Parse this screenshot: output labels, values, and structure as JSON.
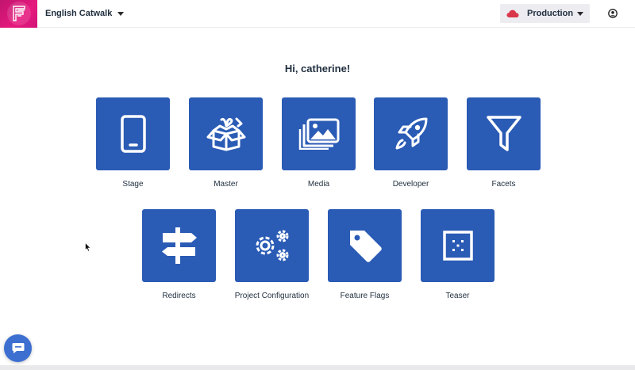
{
  "header": {
    "project_name": "English Catwalk",
    "environment": "Production",
    "brand_color": "#e6197e",
    "environment_icon_color": "#d9364a"
  },
  "main": {
    "greeting": "Hi, catherine!",
    "tile_color": "#2a5bb5",
    "tiles": [
      {
        "label": "Stage",
        "icon": "smartphone-icon"
      },
      {
        "label": "Master",
        "icon": "open-box-icon"
      },
      {
        "label": "Media",
        "icon": "images-icon"
      },
      {
        "label": "Developer",
        "icon": "rocket-icon"
      },
      {
        "label": "Facets",
        "icon": "filter-funnel-icon"
      },
      {
        "label": "Redirects",
        "icon": "signpost-icon"
      },
      {
        "label": "Project Configuration",
        "icon": "gears-icon"
      },
      {
        "label": "Feature Flags",
        "icon": "tag-icon"
      },
      {
        "label": "Teaser",
        "icon": "dotted-square-icon"
      }
    ]
  },
  "chat": {
    "icon": "chat-bubble-icon",
    "color": "#3d6fd1"
  }
}
